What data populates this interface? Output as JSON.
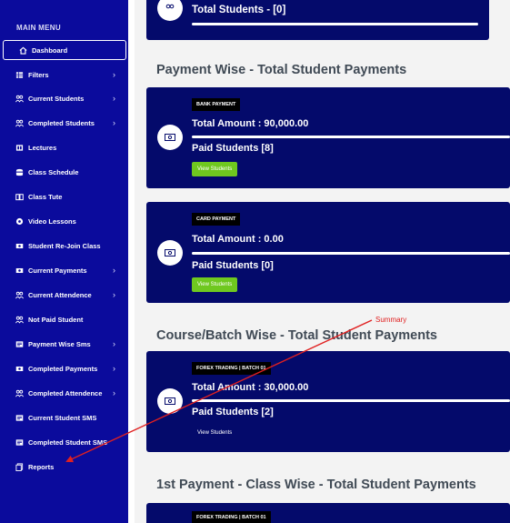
{
  "sidebar": {
    "menu_title": "MAIN MENU",
    "items": [
      {
        "label": "Dashboard",
        "icon": "home-icon",
        "chevron": false,
        "active": true
      },
      {
        "label": "Filters",
        "icon": "filter-icon",
        "chevron": true
      },
      {
        "label": "Current Students",
        "icon": "users-icon",
        "chevron": true
      },
      {
        "label": "Completed Students",
        "icon": "users-icon",
        "chevron": true
      },
      {
        "label": "Lectures",
        "icon": "book-icon",
        "chevron": false
      },
      {
        "label": "Class Schedule",
        "icon": "schedule-icon",
        "chevron": false
      },
      {
        "label": "Class Tute",
        "icon": "book-open-icon",
        "chevron": false
      },
      {
        "label": "Video Lessons",
        "icon": "play-icon",
        "chevron": false
      },
      {
        "label": "Student Re-Join Class",
        "icon": "money-icon",
        "chevron": false
      },
      {
        "label": "Current Payments",
        "icon": "money-icon",
        "chevron": true
      },
      {
        "label": "Current Attendence",
        "icon": "users-icon",
        "chevron": true
      },
      {
        "label": "Not Paid Student",
        "icon": "users-icon",
        "chevron": false
      },
      {
        "label": "Payment Wise Sms",
        "icon": "sms-icon",
        "chevron": true
      },
      {
        "label": "Completed Payments",
        "icon": "money-icon",
        "chevron": true
      },
      {
        "label": "Completed Attendence",
        "icon": "users-icon",
        "chevron": true
      },
      {
        "label": "Current Student SMS",
        "icon": "sms-icon",
        "chevron": false
      },
      {
        "label": "Completed Student SMS",
        "icon": "sms-icon",
        "chevron": false
      },
      {
        "label": "Reports",
        "icon": "report-icon",
        "chevron": false
      }
    ],
    "chevron_glyph": "›"
  },
  "main": {
    "top_card": {
      "title": "Total Students - [0]"
    },
    "sections": [
      {
        "title": "Payment Wise - Total Student Payments"
      },
      {
        "title": "Course/Batch Wise - Total Student Payments"
      },
      {
        "title": "1st Payment - Class Wise - Total Student Payments"
      }
    ],
    "cards": [
      {
        "tag": "BANK PAYMENT",
        "amount": "Total Amount : 90,000.00",
        "paid": "Paid Students [8]",
        "button": "View Students"
      },
      {
        "tag": "CARD PAYMENT",
        "amount": "Total Amount : 0.00",
        "paid": "Paid Students [0]",
        "button": "View Students"
      },
      {
        "tag": "FOREX TRADING | BATCH 01",
        "amount": "Total Amount : 30,000.00",
        "paid": "Paid Students [2]",
        "button": "View Students"
      },
      {
        "tag": "FOREX TRADING | BATCH 01"
      }
    ]
  },
  "annotation": {
    "label": "Summary",
    "color": "#e02020"
  },
  "colors": {
    "sidebar": "#0b0b9c",
    "card": "#040a6b",
    "button": "#6fc81f"
  }
}
